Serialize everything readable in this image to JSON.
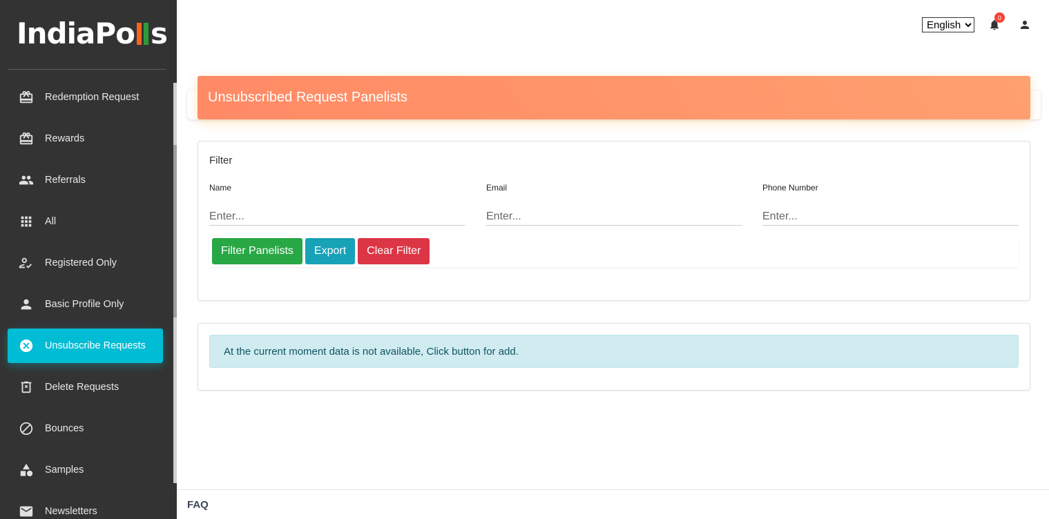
{
  "brand": {
    "logo_prefix": "IndiaPo",
    "logo_suffix": "s"
  },
  "sidebar": {
    "items": [
      {
        "label": "Redemption Request",
        "icon": "gift-icon"
      },
      {
        "label": "Rewards",
        "icon": "gift-icon"
      },
      {
        "label": "Referrals",
        "icon": "people-icon"
      },
      {
        "label": "All",
        "icon": "grid-icon"
      },
      {
        "label": "Registered Only",
        "icon": "person-check-icon"
      },
      {
        "label": "Basic Profile Only",
        "icon": "person-icon"
      },
      {
        "label": "Unsubscribe Requests",
        "icon": "cancel-circle-icon",
        "active": true
      },
      {
        "label": "Delete Requests",
        "icon": "delete-icon"
      },
      {
        "label": "Bounces",
        "icon": "block-icon"
      },
      {
        "label": "Samples",
        "icon": "category-icon"
      },
      {
        "label": "Newsletters",
        "icon": "mail-icon"
      }
    ]
  },
  "topbar": {
    "language": "English",
    "notification_count": "0"
  },
  "page": {
    "title": "Unsubscribed Request Panelists"
  },
  "filter": {
    "title": "Filter",
    "name_label": "Name",
    "name_placeholder": "Enter...",
    "email_label": "Email",
    "email_placeholder": "Enter...",
    "phone_label": "Phone Number",
    "phone_placeholder": "Enter...",
    "filter_button": "Filter Panelists",
    "export_button": "Export",
    "clear_button": "Clear Filter"
  },
  "data": {
    "empty_message": "At the current moment data is not available, Click button for add."
  },
  "footer": {
    "faq": "FAQ"
  },
  "colors": {
    "sidebar_bg": "#333333",
    "active": "#00bcd4",
    "banner": "#ff8a65"
  }
}
